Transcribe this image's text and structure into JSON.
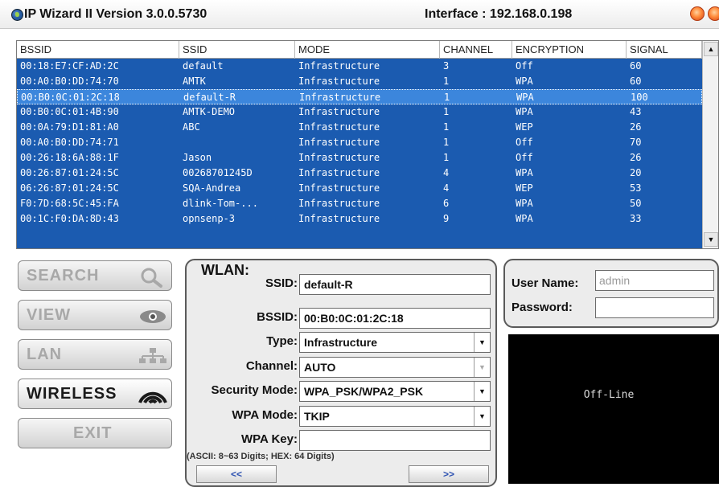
{
  "window": {
    "title": "IP Wizard II  Version 3.0.0.5730",
    "interface": "Interface : 192.168.0.198"
  },
  "table": {
    "columns": [
      "BSSID",
      "SSID",
      "MODE",
      "CHANNEL",
      "ENCRYPTION",
      "SIGNAL"
    ],
    "rows": [
      [
        "00:18:E7:CF:AD:2C",
        "default",
        "Infrastructure",
        "3",
        "Off",
        "60"
      ],
      [
        "00:A0:B0:DD:74:70",
        "AMTK",
        "Infrastructure",
        "1",
        "WPA",
        "60"
      ],
      [
        "00:B0:0C:01:2C:18",
        "default-R",
        "Infrastructure",
        "1",
        "WPA",
        "100"
      ],
      [
        "00:B0:0C:01:4B:90",
        "AMTK-DEMO",
        "Infrastructure",
        "1",
        "WPA",
        "43"
      ],
      [
        "00:0A:79:D1:81:A0",
        "ABC",
        "Infrastructure",
        "1",
        "WEP",
        "26"
      ],
      [
        "00:A0:B0:DD:74:71",
        "",
        "Infrastructure",
        "1",
        "Off",
        "70"
      ],
      [
        "00:26:18:6A:88:1F",
        "Jason",
        "Infrastructure",
        "1",
        "Off",
        "26"
      ],
      [
        "00:26:87:01:24:5C",
        "00268701245D",
        "Infrastructure",
        "4",
        "WPA",
        "20"
      ],
      [
        "06:26:87:01:24:5C",
        "SQA-Andrea",
        "Infrastructure",
        "4",
        "WEP",
        "53"
      ],
      [
        "F0:7D:68:5C:45:FA",
        "dlink-Tom-...",
        "Infrastructure",
        "6",
        "WPA",
        "50"
      ],
      [
        "00:1C:F0:DA:8D:43",
        "opnsenp-3",
        "Infrastructure",
        "9",
        "WPA",
        "33"
      ]
    ],
    "selected_index": 2
  },
  "nav": {
    "search": "SEARCH",
    "view": "VIEW",
    "lan": "LAN",
    "wireless": "WIRELESS",
    "exit": "EXIT"
  },
  "wlan": {
    "title": "WLAN:",
    "ssid_label": "SSID:",
    "ssid_value": "default-R",
    "bssid_label": "BSSID:",
    "bssid_value": "00:B0:0C:01:2C:18",
    "type_label": "Type:",
    "type_value": "Infrastructure",
    "channel_label": "Channel:",
    "channel_value": "AUTO",
    "security_label": "Security Mode:",
    "security_value": "WPA_PSK/WPA2_PSK",
    "wpa_mode_label": "WPA Mode:",
    "wpa_mode_value": "TKIP",
    "wpa_key_label": "WPA Key:",
    "wpa_key_value": "",
    "note": "(ASCII: 8~63 Digits; HEX: 64 Digits)",
    "prev": "<<",
    "next": ">>"
  },
  "login": {
    "username_label": "User Name:",
    "username_value": "admin",
    "password_label": "Password:",
    "password_value": ""
  },
  "status": {
    "text": "Off-Line"
  },
  "colors": {
    "list_bg": "#1b5bb0",
    "selected_row": "#3c86dc",
    "button_label_inactive": "#a8a8a8"
  }
}
